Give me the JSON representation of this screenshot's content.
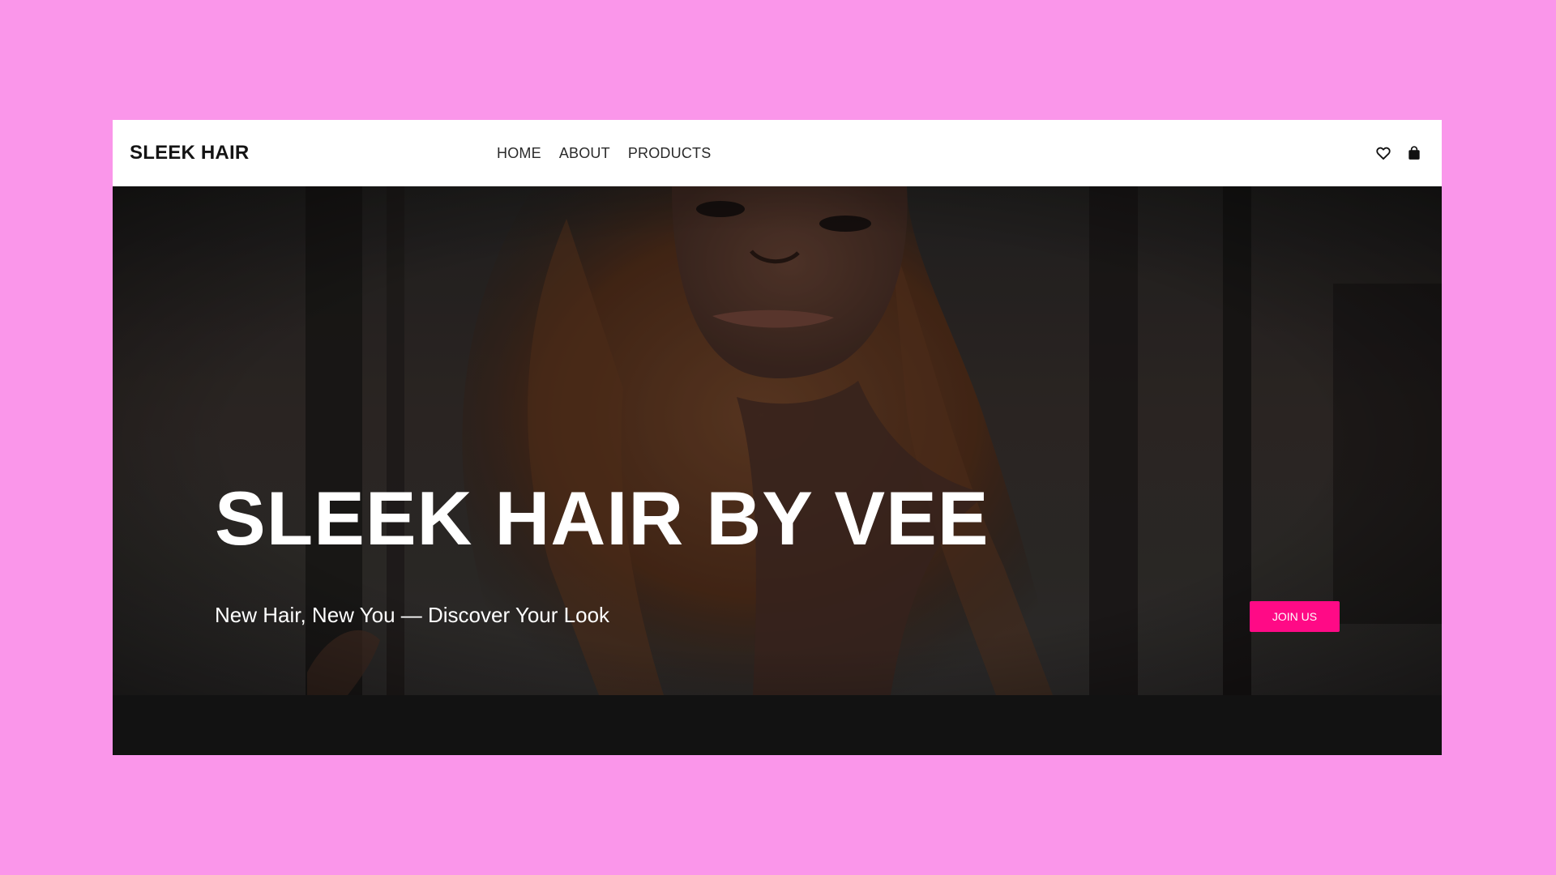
{
  "header": {
    "brand": "SLEEK HAIR",
    "nav": [
      {
        "label": "HOME"
      },
      {
        "label": "ABOUT"
      },
      {
        "label": "PRODUCTS"
      }
    ],
    "icons": [
      "heart-icon",
      "shopping-bag-icon"
    ]
  },
  "hero": {
    "title": "SLEEK HAIR BY VEE",
    "subtitle": "New Hair, New You — Discover Your Look",
    "cta_label": "JOIN US"
  },
  "colors": {
    "page_background": "#fa96ea",
    "cta": "#ff0a86",
    "header_background": "#ffffff",
    "footer_strip": "#121212"
  }
}
